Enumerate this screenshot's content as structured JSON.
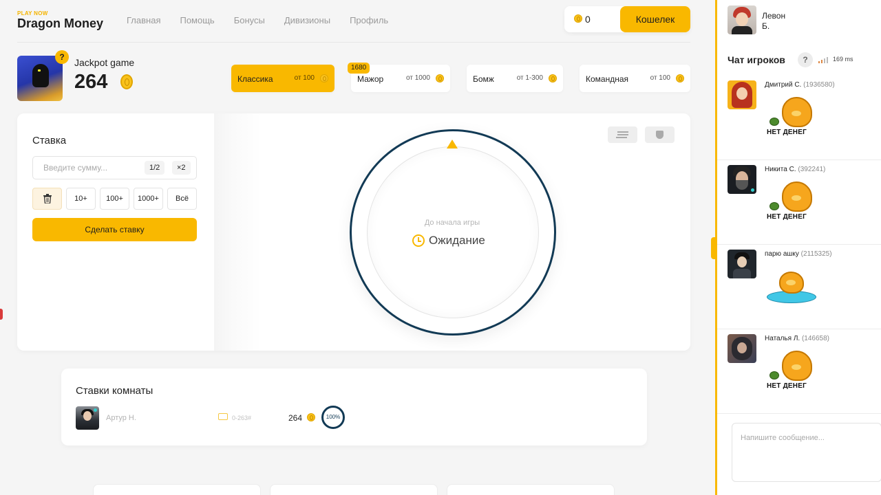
{
  "brand": {
    "tag": "PLAY NOW",
    "name": "Dragon Money"
  },
  "nav": [
    {
      "label": "Главная"
    },
    {
      "label": "Помощь"
    },
    {
      "label": "Бонусы"
    },
    {
      "label": "Дивизионы"
    },
    {
      "label": "Профиль"
    }
  ],
  "wallet": {
    "balance": "0",
    "button_label": "Кошелек"
  },
  "jackpot": {
    "help": "?",
    "title": "Jackpot game",
    "value": "264"
  },
  "modes": [
    {
      "name": "Классика",
      "from": "от 100",
      "active": true
    },
    {
      "name": "Мажор",
      "from": "от 1000",
      "badge": "1680"
    },
    {
      "name": "Бомж",
      "from": "от 1-300"
    },
    {
      "name": "Командная",
      "from": "от 100"
    }
  ],
  "bet": {
    "title": "Ставка",
    "input_value": "",
    "input_placeholder": "Введите сумму...",
    "half_label": "1/2",
    "double_label": "×2",
    "quick": [
      "10+",
      "100+",
      "1000+",
      "Всё"
    ],
    "submit_label": "Сделать ставку"
  },
  "game": {
    "sub": "До начала игры",
    "status": "Ожидание"
  },
  "room": {
    "title": "Ставки комнаты",
    "rows": [
      {
        "name": "Артур Н.",
        "range": "0-263#",
        "amount": "264",
        "percent": "100%"
      }
    ]
  },
  "user": {
    "first": "Левон",
    "last": "Б."
  },
  "chat": {
    "title": "Чат игроков",
    "help": "?",
    "ping": "169 ms",
    "messages": [
      {
        "name": "Дмитрий С.",
        "id": "(1936580)",
        "sticker": "НЕТ ДЕНЕГ"
      },
      {
        "name": "Никита С.",
        "id": "(392241)",
        "sticker": "НЕТ ДЕНЕГ"
      },
      {
        "name": "парю ашку",
        "id": "(2115325)",
        "sticker": ""
      },
      {
        "name": "Наталья Л.",
        "id": "(146658)",
        "sticker": "НЕТ ДЕНЕГ"
      }
    ],
    "input_value": "",
    "input_placeholder": "Напишите сообщение..."
  },
  "colors": {
    "accent": "#f9b800",
    "ring": "#123a55"
  }
}
